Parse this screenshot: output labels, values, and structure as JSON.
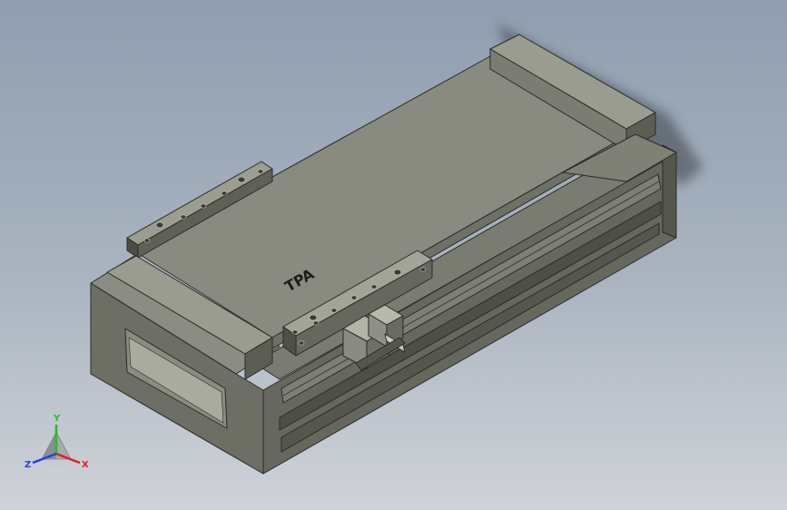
{
  "viewport": {
    "background_top": "#8f9eb0",
    "background_bottom": "#cfd3d8"
  },
  "model": {
    "name": "linear-module",
    "logo_text": "TPA",
    "colors": {
      "top": "#898b80",
      "front": "#6f7166",
      "side": "#5c5e54",
      "edge": "#2a2b26",
      "highlight": "#a2a497"
    }
  },
  "triad": {
    "x_label": "X",
    "y_label": "Y",
    "z_label": "Z",
    "x_color": "#e02020",
    "y_color": "#20c020",
    "z_color": "#2040e0"
  }
}
